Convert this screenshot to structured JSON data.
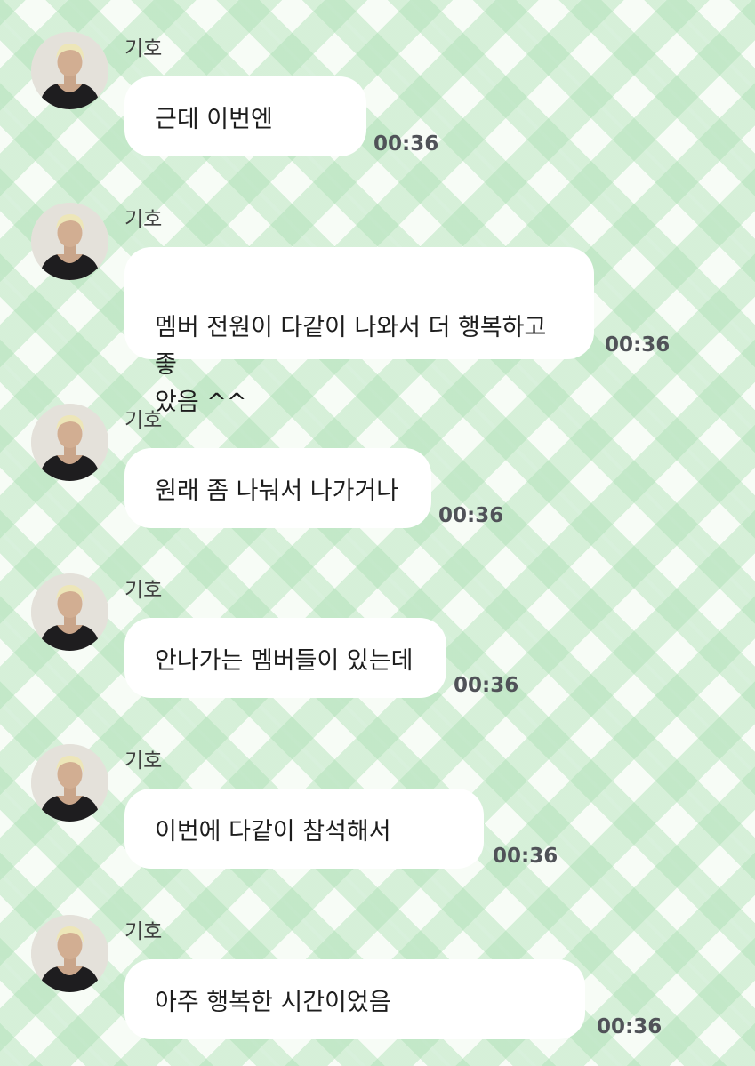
{
  "colors": {
    "plaid_green": "#a8deb0",
    "bubble": "#ffffff",
    "sender_text": "#3e3e3e",
    "time_text": "#505258"
  },
  "messages": [
    {
      "sender": "기호",
      "text": "근데 이번엔",
      "time": "00:36"
    },
    {
      "sender": "기호",
      "text": "멤버 전원이 다같이 나와서 더 행복하고 좋\n았음 ^^",
      "time": "00:36"
    },
    {
      "sender": "기호",
      "text": "원래 좀 나눠서 나가거나",
      "time": "00:36"
    },
    {
      "sender": "기호",
      "text": "안나가는 멤버들이 있는데",
      "time": "00:36"
    },
    {
      "sender": "기호",
      "text": "이번에 다같이 참석해서",
      "time": "00:36"
    },
    {
      "sender": "기호",
      "text": "아주 행복한 시간이었음",
      "time": "00:36"
    }
  ]
}
